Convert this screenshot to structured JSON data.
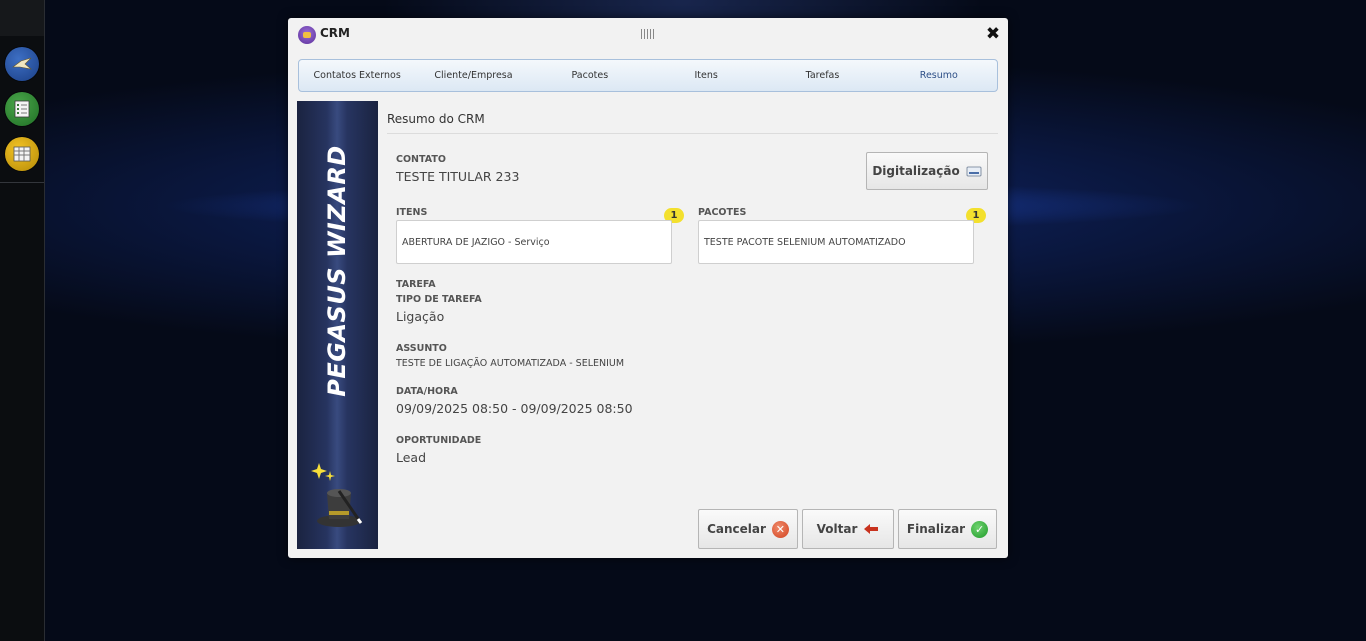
{
  "dialog": {
    "title": "CRM",
    "close_icon": "close-icon"
  },
  "tabs": [
    {
      "label": "Contatos Externos"
    },
    {
      "label": "Cliente/Empresa"
    },
    {
      "label": "Pacotes"
    },
    {
      "label": "Itens"
    },
    {
      "label": "Tarefas"
    },
    {
      "label": "Resumo",
      "active": true
    }
  ],
  "banner": {
    "text": "PEGASUS WIZARD"
  },
  "summary": {
    "title": "Resumo do CRM",
    "contato_label": "CONTATO",
    "contato_value": "TESTE TITULAR 233",
    "digitalizacao_label": "Digitalização",
    "itens_label": "ITENS",
    "itens_count": "1",
    "itens_value": "ABERTURA DE JAZIGO - Serviço",
    "pacotes_label": "PACOTES",
    "pacotes_count": "1",
    "pacotes_value": "TESTE PACOTE SELENIUM AUTOMATIZADO",
    "tarefa_label": "TAREFA",
    "tipo_tarefa_label": "TIPO DE TAREFA",
    "tipo_tarefa_value": "Ligação",
    "assunto_label": "ASSUNTO",
    "assunto_value": "TESTE DE LIGAÇÃO AUTOMATIZADA - SELENIUM",
    "data_hora_label": "DATA/HORA",
    "data_hora_value": "09/09/2025 08:50 - 09/09/2025 08:50",
    "oportunidade_label": "OPORTUNIDADE",
    "oportunidade_value": "Lead"
  },
  "footer": {
    "cancel_label": "Cancelar",
    "back_label": "Voltar",
    "finish_label": "Finalizar"
  },
  "colors": {
    "accent_tab": "#2e4f87",
    "badge": "#f3e02e",
    "cancel_icon": "#d1421f",
    "finish_icon": "#1f9a2a"
  }
}
